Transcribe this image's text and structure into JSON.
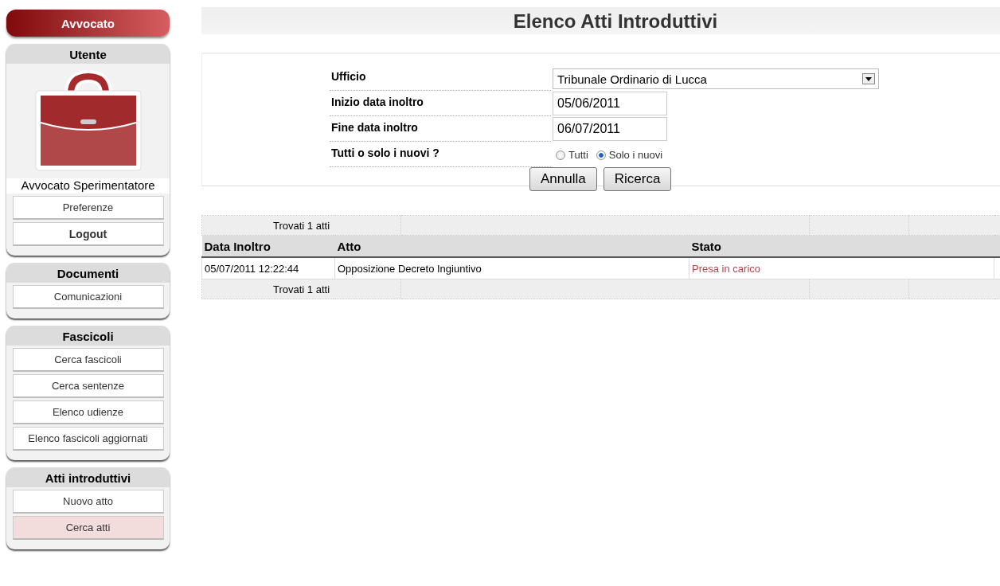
{
  "sidebar": {
    "role_button": "Avvocato",
    "sections": [
      {
        "title": "Utente",
        "user_name": "Avvocato Sperimentatore",
        "items": [
          {
            "label": "Preferenze",
            "selected": false,
            "bold": false
          },
          {
            "label": "Logout",
            "selected": false,
            "bold": true
          }
        ]
      },
      {
        "title": "Documenti",
        "items": [
          {
            "label": "Comunicazioni",
            "selected": false,
            "bold": false
          }
        ]
      },
      {
        "title": "Fascicoli",
        "items": [
          {
            "label": "Cerca fascicoli",
            "selected": false,
            "bold": false
          },
          {
            "label": "Cerca sentenze",
            "selected": false,
            "bold": false
          },
          {
            "label": "Elenco udienze",
            "selected": false,
            "bold": false
          },
          {
            "label": "Elenco fascicoli aggiornati",
            "selected": false,
            "bold": false
          }
        ]
      },
      {
        "title": "Atti introduttivi",
        "items": [
          {
            "label": "Nuovo atto",
            "selected": false,
            "bold": false
          },
          {
            "label": "Cerca atti",
            "selected": true,
            "bold": false
          }
        ]
      }
    ]
  },
  "page_title": "Elenco Atti Introduttivi",
  "form": {
    "ufficio": {
      "label": "Ufficio",
      "value": "Tribunale Ordinario di Lucca"
    },
    "inizio": {
      "label": "Inizio data inoltro",
      "value": "05/06/2011"
    },
    "fine": {
      "label": "Fine data inoltro",
      "value": "06/07/2011"
    },
    "filter": {
      "label": "Tutti o solo i nuovi ?",
      "options": [
        {
          "label": "Tutti",
          "selected": false
        },
        {
          "label": "Solo i nuovi",
          "selected": true
        }
      ]
    },
    "buttons": [
      "Annulla",
      "Ricerca"
    ]
  },
  "results": {
    "pager_top": "Trovati 1 atti",
    "columns": [
      "Data Inoltro",
      "Atto",
      "Stato"
    ],
    "rows": [
      {
        "data": "05/07/2011 12:22:44",
        "atto": "Opposizione Decreto Ingiuntivo",
        "stato": "Presa in carico"
      }
    ],
    "pager_bottom": "Trovati 1 atti"
  }
}
